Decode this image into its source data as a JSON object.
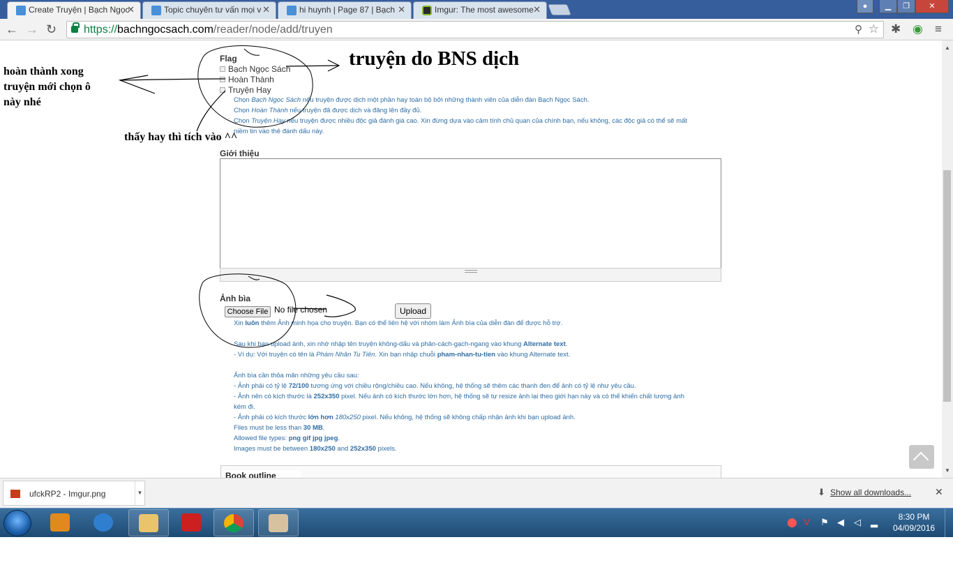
{
  "browser": {
    "tabs": [
      {
        "title": "Create Truyện | Bạch Ngọc",
        "active": true,
        "icon": "bns-favicon"
      },
      {
        "title": "Topic chuyên tư vấn mọi v",
        "active": false,
        "icon": "bns-favicon"
      },
      {
        "title": "hi huynh | Page 87 | Bạch",
        "active": false,
        "icon": "bns-favicon"
      },
      {
        "title": "Imgur: The most awesome",
        "active": false,
        "icon": "imgur-favicon"
      }
    ],
    "url_protocol": "https://",
    "url_host": "bachngocsach.com",
    "url_path": "/reader/node/add/truyen"
  },
  "page": {
    "flag_label": "Flag",
    "flag_options": [
      "Bạch Ngọc Sách",
      "Hoàn Thành",
      "Truyện Hay"
    ],
    "flag_desc_1_pre": "Chọn ",
    "flag_desc_1_em": "Bạch Ngọc Sách",
    "flag_desc_1_post": " nếu truyện được dịch một phần hay toàn bộ bởi những thành viên của diễn đàn Bạch Ngọc Sách.",
    "flag_desc_2_pre": "Chọn ",
    "flag_desc_2_em": "Hoàn Thành",
    "flag_desc_2_post": " nếu truyện đã được dịch và đăng lên đầy đủ.",
    "flag_desc_3_pre": "Chọn ",
    "flag_desc_3_em": "Truyện Hay",
    "flag_desc_3_post": " nếu truyện được nhiều độc giả đánh giá cao. Xin đừng dựa vào cảm tính chủ quan của chính bạn, nếu không, các độc giả có thể sẽ mất",
    "flag_desc_4": "niềm tin vào thẻ đánh dấu này.",
    "intro_label": "Giới thiệu",
    "cover_label": "Ảnh bìa",
    "choose_file": "Choose File",
    "no_file": "No file chosen",
    "upload_button": "Upload",
    "cover_desc_1_pre": "Xin ",
    "cover_desc_1_b": "luôn",
    "cover_desc_1_post": " thêm Ảnh minh họa cho truyện. Bạn có thể liên hệ với nhóm làm Ảnh bìa của diễn đàn để được hỗ trợ.",
    "cover_desc_2_pre": "Sau khi bạn upload ảnh, xin nhớ nhập tên truyện không-dấu và phân-cách-gạch-ngang vào khung ",
    "cover_desc_2_b": "Alternate text",
    "cover_desc_2_post": ".",
    "cover_desc_3_pre": "- Ví dụ: Với truyện có tên là ",
    "cover_desc_3_em": "Phàm Nhân Tu Tiên",
    "cover_desc_3_mid": ". Xin bạn nhập chuỗi ",
    "cover_desc_3_b": "pham-nhan-tu-tien",
    "cover_desc_3_post": " vào khung Alternate text.",
    "cover_req_title": "Ảnh bìa cần thỏa mãn những yêu cầu sau:",
    "req_1_pre": "- Ảnh phải có tỷ lệ ",
    "req_1_b": "72/100",
    "req_1_post": " tương ứng với chiều rộng/chiều cao. Nếu không, hệ thống sẽ thêm các thanh đen để ảnh có tỷ lệ như yêu cầu.",
    "req_2_pre": "- Ảnh nên có kích thước là ",
    "req_2_b": "252x350",
    "req_2_post": " pixel. Nếu ảnh có kích thước lớn hơn, hệ thống sẽ tự resize ảnh lại theo giới hạn này và có thể khiến chất lượng ảnh",
    "req_2_cont": "kém đi.",
    "req_3_pre": "- Ảnh phải có kích thước ",
    "req_3_b": "lớn hơn",
    "req_3_em": " 180x250",
    "req_3_post": " pixel. Nếu không, hệ thống sẽ không chấp nhận ảnh khi bạn upload ảnh.",
    "files_pre": "Files must be less than ",
    "files_b": "30 MB",
    "files_post": ".",
    "types_pre": "Allowed file types: ",
    "types_b": "png gif jpg jpeg",
    "types_post": ".",
    "images_pre": "Images must be between ",
    "images_b1": "180x250",
    "images_mid": " and ",
    "images_b2": "252x350",
    "images_post": " pixels.",
    "book_outline": "Book outline"
  },
  "annotations": {
    "top_right": "truyện do BNS dịch",
    "left_1": "hoàn thành xong",
    "left_2": "truyện mới chọn ô",
    "left_3": "này nhé",
    "middle": "thấy hay thì tích vào ^^"
  },
  "downloads": {
    "file": "ufckRP2 - Imgur.png",
    "show_all": "Show all downloads..."
  },
  "taskbar": {
    "time": "8:30 PM",
    "date": "04/09/2016",
    "apps": [
      "media-player-icon",
      "internet-explorer-icon",
      "file-explorer-icon",
      "avira-icon",
      "chrome-icon",
      "paint-icon"
    ]
  }
}
